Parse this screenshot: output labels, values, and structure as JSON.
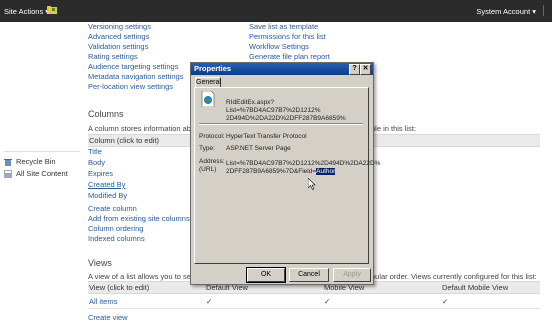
{
  "topbar": {
    "site_actions": "Site Actions ▾",
    "account": "System Account ▾"
  },
  "settings": {
    "left": [
      "Versioning settings",
      "Advanced settings",
      "Validation settings",
      "Rating settings",
      "Audience targeting settings",
      "Metadata navigation settings",
      "Per-location view settings"
    ],
    "right": [
      "Save list as template",
      "Permissions for this list",
      "Workflow Settings",
      "Generate file plan report"
    ]
  },
  "columns": {
    "title": "Columns",
    "description": "A column stores information about",
    "description_right": "ble in this list:",
    "header": "Column (click to edit)",
    "items": [
      "Title",
      "Body",
      "Expires",
      "Created By",
      "Modified By"
    ],
    "links": [
      "Create column",
      "Add from existing site columns",
      "Column ordering",
      "Indexed columns"
    ]
  },
  "leftnav": {
    "items": [
      "Recycle Bin",
      "All Site Content"
    ]
  },
  "views": {
    "title": "Views",
    "description": "A view of a list allows you to see a",
    "description_right": "pular order. Views currently configured for this list:",
    "headers": [
      "View (click to edit)",
      "Default View",
      "Mobile View",
      "Default Mobile View"
    ],
    "row": [
      "All items",
      "✓",
      "✓",
      "✓"
    ],
    "create": "Create view"
  },
  "dialog": {
    "title": "Properties",
    "tab": "General",
    "address_top_1": "RIdEditEx.aspx?List=%7BD4AC97B7%2D1212%",
    "address_top_2": "2D494D%2DA22D%2DFF287B9A6859%",
    "protocol_label": "Protocol:",
    "protocol_value": "HyperText Transfer Protocol",
    "type_label": "Type:",
    "type_value": "ASP.NET Server Page",
    "address_label": "Address:",
    "url_label": "(URL)",
    "address_1": "List=%7BD4AC97B7%2D1212%2D494D%2DA22D%",
    "address_2": "2DFF287B9A6859%7D&Field=",
    "address_highlight": "Author",
    "ok": "OK",
    "cancel": "Cancel",
    "apply": "Apply"
  }
}
